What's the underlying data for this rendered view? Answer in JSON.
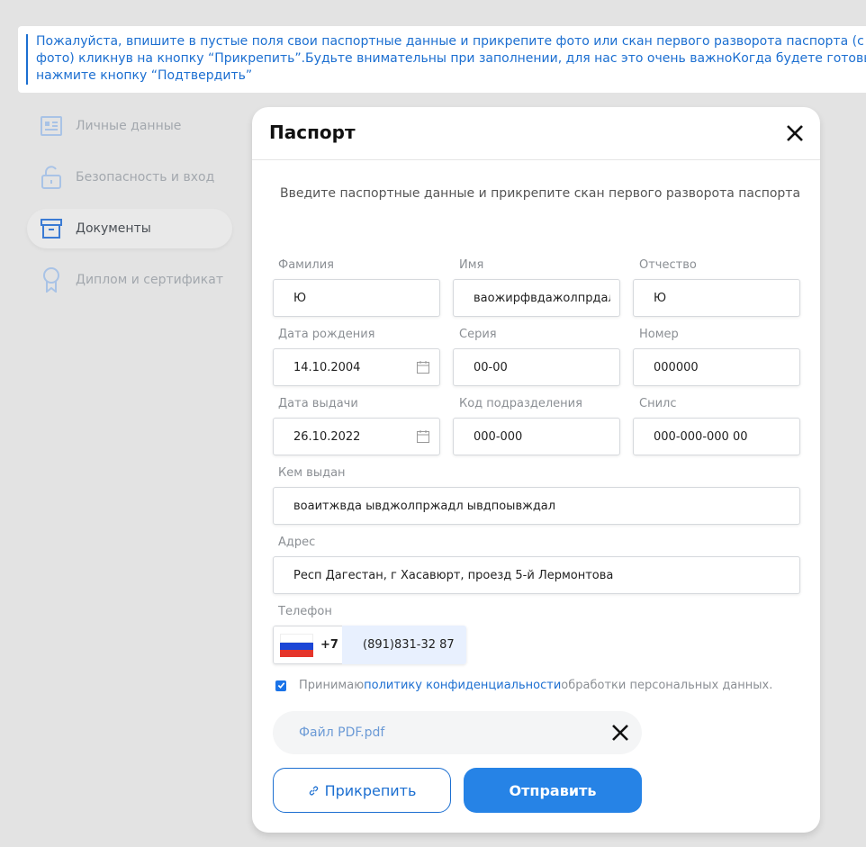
{
  "notice": {
    "text": "Пожалуйста, впишите в пустые поля свои паспортные данные и прикрепите фото или скан первого разворота паспорта (с фото) кликнув на кнопку “Прикрепить”.Будьте внимательны при заполнении, для нас это очень важноКогда будете готовы нажмите кнопку “Подтвердить”"
  },
  "sidebar": {
    "items": [
      {
        "label": "Личные данные",
        "icon": "id-card-icon"
      },
      {
        "label": "Безопасность и вход",
        "icon": "unlock-icon"
      },
      {
        "label": "Документы",
        "icon": "archive-icon",
        "active": true
      },
      {
        "label": "Диплом и сертификат",
        "icon": "award-icon"
      }
    ]
  },
  "modal": {
    "title": "Паспорт",
    "subtitle": "Введите паспортные данные и прикрепите скан первого разворота паспорта",
    "fields": {
      "surname": {
        "label": "Фамилия",
        "value": "Ю"
      },
      "name": {
        "label": "Имя",
        "value": "ваожирфвдажолпрдалд;"
      },
      "patronymic": {
        "label": "Отчество",
        "value": "Ю"
      },
      "birth_date": {
        "label": "Дата рождения",
        "value": "14.10.2004"
      },
      "series": {
        "label": "Серия",
        "value": "00-00"
      },
      "number": {
        "label": "Номер",
        "value": "000000"
      },
      "issue_date": {
        "label": "Дата выдачи",
        "value": "26.10.2022"
      },
      "department_code": {
        "label": "Код подразделения",
        "value": "000-000"
      },
      "snils": {
        "label": "Снилс",
        "value": "000-000-000 00"
      },
      "issued_by": {
        "label": "Кем выдан",
        "value": "воаитжвда ывджолпржадл ывдпоывждал"
      },
      "address": {
        "label": "Адрес",
        "value": "Респ Дагестан, г Хасавюрт, проезд 5-й Лермонтова"
      },
      "phone": {
        "label": "Телефон",
        "country_code": "+7",
        "value": "(891)831-32 87"
      }
    },
    "consent": {
      "prefix": "Принимаю ",
      "link": "политику конфиденциальности",
      "suffix": " обработки персональных данных.",
      "checked": true
    },
    "file": {
      "name": "Файл PDF.pdf"
    },
    "buttons": {
      "attach": "Прикрепить",
      "send": "Отправить"
    }
  },
  "colors": {
    "accent": "#1c6fd1",
    "button": "#2683e6",
    "background": "#e3e3e3"
  }
}
